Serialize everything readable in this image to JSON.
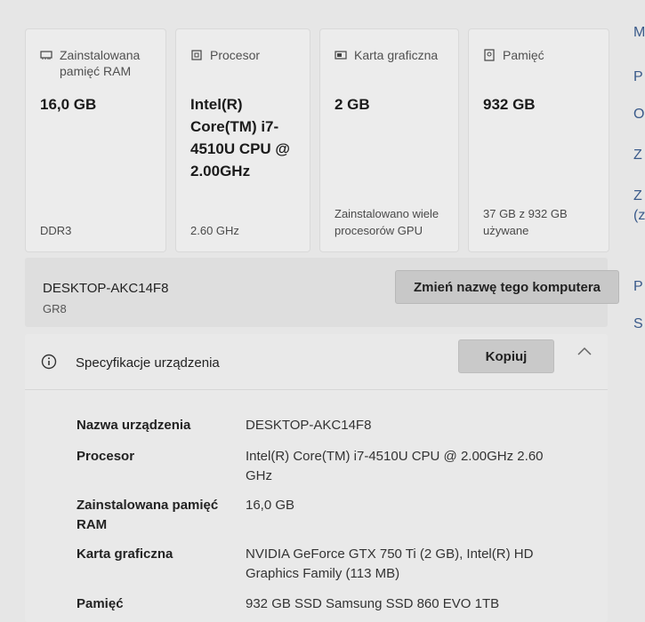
{
  "cards": [
    {
      "label": "Zainstalowana pamięć RAM",
      "icon": "ram-icon",
      "value": "16,0 GB",
      "sub": "DDR3"
    },
    {
      "label": "Procesor",
      "icon": "processor-icon",
      "value": "Intel(R) Core(TM) i7-4510U CPU @ 2.00GHz",
      "sub": "2.60 GHz"
    },
    {
      "label": "Karta graficzna",
      "icon": "graphics-card-icon",
      "value": "2 GB",
      "sub": "Zainstalowano wiele procesorów GPU"
    },
    {
      "label": "Pamięć",
      "icon": "storage-icon",
      "value": "932 GB",
      "sub": "37 GB z 932 GB używane"
    }
  ],
  "device": {
    "name": "DESKTOP-AKC14F8",
    "group": "GR8",
    "rename_label": "Zmień nazwę tego komputera"
  },
  "specs": {
    "title": "Specyfikacje urządzenia",
    "copy_label": "Kopiuj",
    "rows": [
      {
        "key": "Nazwa urządzenia",
        "value": "DESKTOP-AKC14F8"
      },
      {
        "key": "Procesor",
        "value": "Intel(R) Core(TM) i7-4510U CPU @ 2.00GHz 2.60 GHz"
      },
      {
        "key": "Zainstalowana pamięć RAM",
        "value": "16,0 GB"
      },
      {
        "key": "Karta graficzna",
        "value": "NVIDIA GeForce GTX 750 Ti (2 GB), Intel(R) HD Graphics Family (113 MB)"
      },
      {
        "key": "Pamięć",
        "value": "932 GB SSD Samsung SSD 860 EVO 1TB"
      }
    ]
  },
  "right_column": {
    "letters": [
      "M",
      "P",
      "O",
      "Z",
      "Z",
      "(z",
      "P",
      "S"
    ]
  }
}
